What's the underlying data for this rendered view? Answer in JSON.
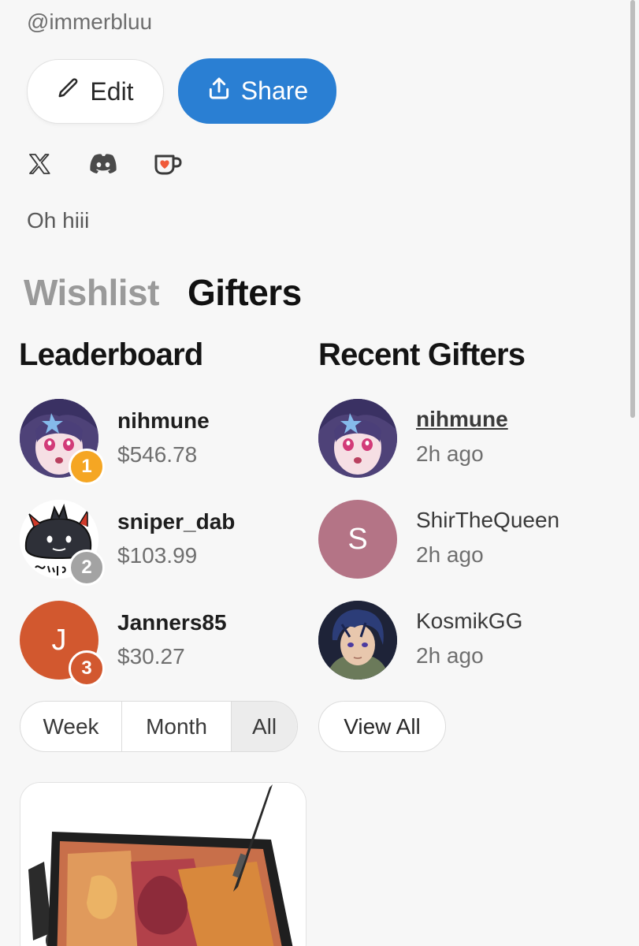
{
  "profile": {
    "handle": "@immerbluu",
    "bio": "Oh hiii"
  },
  "actions": {
    "edit_label": "Edit",
    "share_label": "Share"
  },
  "socials": [
    "x-icon",
    "discord-icon",
    "kofi-icon"
  ],
  "tabs": [
    {
      "label": "Wishlist",
      "active": false
    },
    {
      "label": "Gifters",
      "active": true
    }
  ],
  "leaderboard": {
    "title": "Leaderboard",
    "entries": [
      {
        "rank": "1",
        "name": "nihmune",
        "amount": "$546.78",
        "badge_color": "#f5a623"
      },
      {
        "rank": "2",
        "name": "sniper_dab",
        "amount": "$103.99",
        "badge_color": "#a3a3a3"
      },
      {
        "rank": "3",
        "name": "Janners85",
        "amount": "$30.27",
        "initial": "J",
        "avatar_color": "#d2582f",
        "badge_color": "#d2582f"
      }
    ],
    "filters": [
      {
        "label": "Week",
        "selected": false
      },
      {
        "label": "Month",
        "selected": false
      },
      {
        "label": "All",
        "selected": true
      }
    ]
  },
  "recent": {
    "title": "Recent Gifters",
    "entries": [
      {
        "name": "nihmune",
        "time": "2h ago"
      },
      {
        "name": "ShirTheQueen",
        "time": "2h ago",
        "initial": "S",
        "avatar_color": "#b47486"
      },
      {
        "name": "KosmikGG",
        "time": "2h ago"
      }
    ],
    "view_all_label": "View All"
  },
  "colors": {
    "accent": "#2a7fd3",
    "background": "#f7f7f7"
  }
}
